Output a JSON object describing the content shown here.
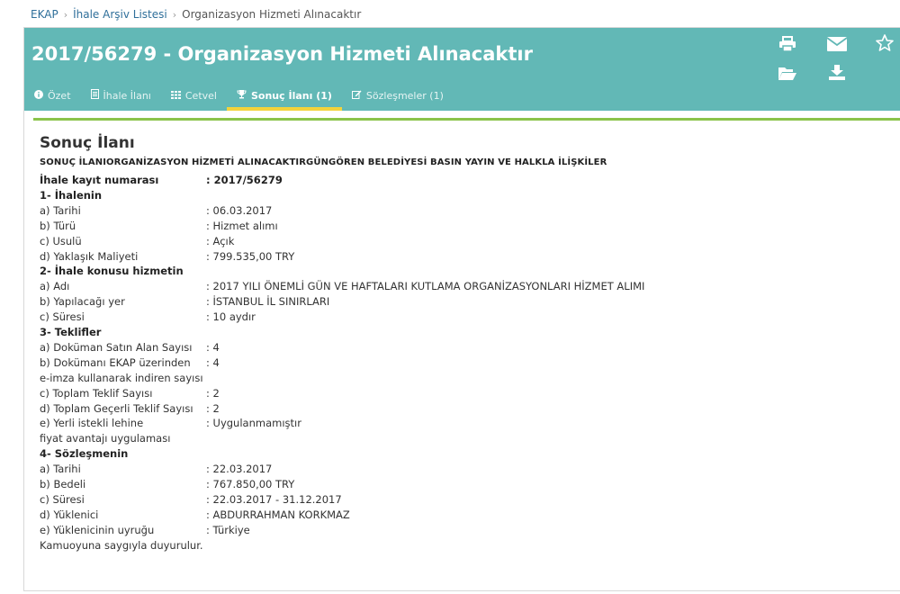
{
  "breadcrumb": {
    "home": "EKAP",
    "archive": "İhale Arşiv Listesi",
    "current": "Organizasyon Hizmeti Alınacaktır"
  },
  "header": {
    "title": "2017/56279 - Organizasyon Hizmeti Alınacaktır",
    "icons": [
      "print-icon",
      "mail-icon",
      "star-icon",
      "folder-open-icon",
      "download-icon"
    ],
    "accent_color": "#62b8b6",
    "active_tab_color": "#f3d33c"
  },
  "tabs": [
    {
      "label": "Özet",
      "icon": "info-icon"
    },
    {
      "label": "İhale İlanı",
      "icon": "document-icon"
    },
    {
      "label": "Cetvel",
      "icon": "grid-icon"
    },
    {
      "label": "Sonuç İlanı (1)",
      "icon": "trophy-icon",
      "active": true
    },
    {
      "label": "Sözleşmeler (1)",
      "icon": "edit-icon"
    }
  ],
  "content": {
    "heading": "Sonuç İlanı",
    "subtitle": "SONUÇ İLANIORGANİZASYON HİZMETİ ALINACAKTIRGÜNGÖREN BELEDİYESİ BASIN YAYIN VE HALKLA İLİŞKİLER",
    "rows": [
      {
        "label": "İhale kayıt numarası",
        "value": ":  2017/56279",
        "bold": true
      },
      {
        "label": "1- İhalenin",
        "value": "",
        "bold": true
      },
      {
        "label": "a) Tarihi",
        "value": ":  06.03.2017"
      },
      {
        "label": "b) Türü",
        "value": ":  Hizmet alımı"
      },
      {
        "label": "c) Usulü",
        "value": ":  Açık"
      },
      {
        "label": "d) Yaklaşık Maliyeti",
        "value": ":  799.535,00 TRY"
      },
      {
        "label": "2- İhale konusu hizmetin",
        "value": "",
        "bold": true
      },
      {
        "label": "a) Adı",
        "value": ":  2017 YILI ÖNEMLİ GÜN VE HAFTALARI KUTLAMA ORGANİZASYONLARI HİZMET ALIMI"
      },
      {
        "label": "b) Yapılacağı yer",
        "value": ":  İSTANBUL İL SINIRLARI"
      },
      {
        "label": "c) Süresi",
        "value": ":  10 aydır"
      },
      {
        "label": "3- Teklifler",
        "value": "",
        "bold": true
      },
      {
        "label": "a) Doküman Satın Alan Sayısı",
        "value": ":  4"
      },
      {
        "label": "b) Dokümanı EKAP üzerinden",
        "value": ":  4"
      },
      {
        "label": "e-imza kullanarak indiren sayısı",
        "value": ""
      },
      {
        "label": "c) Toplam Teklif Sayısı",
        "value": ":  2"
      },
      {
        "label": "d) Toplam Geçerli Teklif Sayısı",
        "value": ":  2"
      },
      {
        "label": "e) Yerli istekli lehine",
        "value": ":  Uygulanmamıştır"
      },
      {
        "label": "fiyat avantajı uygulaması",
        "value": ""
      },
      {
        "label": "4- Sözleşmenin",
        "value": "",
        "bold": true
      },
      {
        "label": "a) Tarihi",
        "value": ":  22.03.2017"
      },
      {
        "label": "b) Bedeli",
        "value": ":  767.850,00 TRY"
      },
      {
        "label": "c) Süresi",
        "value": ":  22.03.2017 - 31.12.2017"
      },
      {
        "label": "d) Yüklenici",
        "value": ":  ABDURRAHMAN KORKMAZ"
      },
      {
        "label": "e) Yüklenicinin uyruğu",
        "value": ":  Türkiye"
      },
      {
        "label": "Kamuoyuna saygıyla duyurulur.",
        "value": ""
      }
    ]
  }
}
